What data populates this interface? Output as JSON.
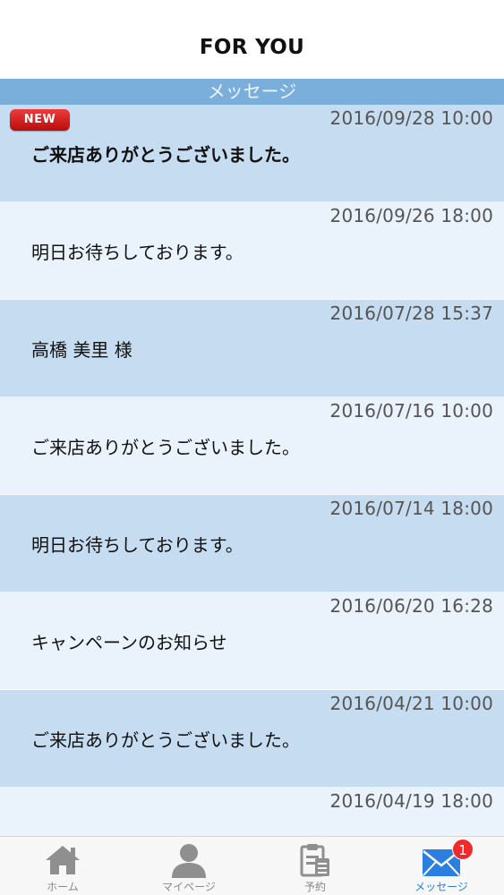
{
  "header": {
    "title": "FOR YOU"
  },
  "section": {
    "title": "メッセージ"
  },
  "badges": {
    "new": "NEW"
  },
  "messages": [
    {
      "date": "2016/09/28 10:00",
      "text": "ご来店ありがとうございました。",
      "is_new": true
    },
    {
      "date": "2016/09/26 18:00",
      "text": "明日お待ちしております。"
    },
    {
      "date": "2016/07/28 15:37",
      "text": "高橋 美里 様"
    },
    {
      "date": "2016/07/16 10:00",
      "text": "ご来店ありがとうございました。"
    },
    {
      "date": "2016/07/14 18:00",
      "text": "明日お待ちしております。"
    },
    {
      "date": "2016/06/20 16:28",
      "text": "キャンペーンのお知らせ"
    },
    {
      "date": "2016/04/21 10:00",
      "text": "ご来店ありがとうございました。"
    },
    {
      "date": "2016/04/19 18:00",
      "text": ""
    }
  ],
  "tabbar": {
    "items": [
      {
        "label": "ホーム",
        "icon": "home-icon"
      },
      {
        "label": "マイページ",
        "icon": "person-icon"
      },
      {
        "label": "予約",
        "icon": "clipboard-icon"
      },
      {
        "label": "メッセージ",
        "icon": "envelope-icon",
        "badge": "1",
        "active": true
      }
    ]
  },
  "colors": {
    "section_header": "#7aaedb",
    "row_dark": "#c6dcf0",
    "row_light": "#eaf2fb",
    "active_tab": "#2a7fe0",
    "badge_red": "#ee2a2a"
  }
}
